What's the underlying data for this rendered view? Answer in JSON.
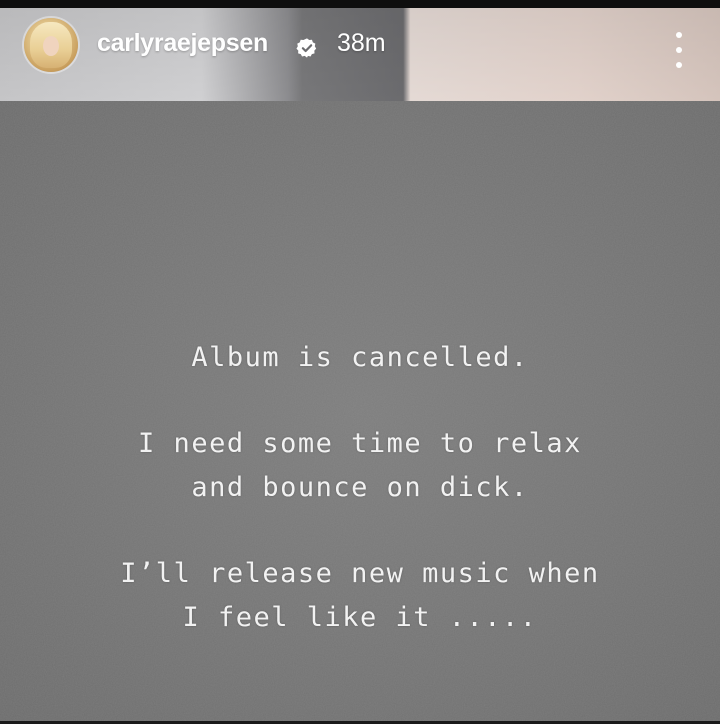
{
  "header": {
    "username": "carlyraejepsen",
    "verified_icon": "verified-badge-icon",
    "timestamp": "38m",
    "more_icon": "more-vertical-icon",
    "avatar_icon": "profile-avatar"
  },
  "story": {
    "paragraph_1": {
      "line_1": "Album is cancelled."
    },
    "paragraph_2": {
      "line_1": "I need some time to relax",
      "line_2": "and bounce on dick."
    },
    "paragraph_3": {
      "line_1": "I’ll release new music when",
      "line_2": "I feel like it ....."
    }
  },
  "colors": {
    "story_background": "#767676",
    "text": "#f2f2f2",
    "header_text": "#ffffff"
  }
}
